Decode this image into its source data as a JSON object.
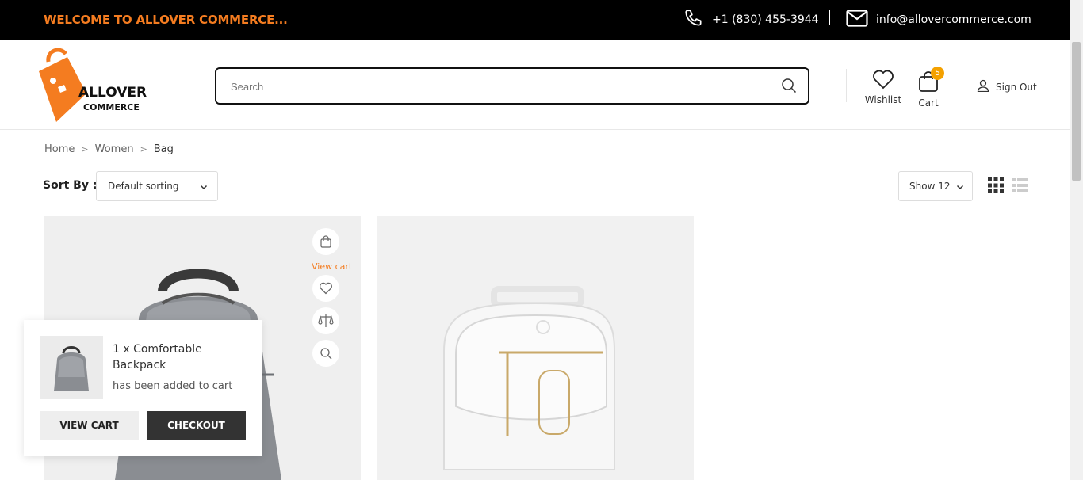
{
  "topbar": {
    "welcome": "WELCOME TO ALLOVER COMMERCE...",
    "phone": "+1 (830) 455-3944",
    "email": "info@allovercommerce.com"
  },
  "logo": {
    "line1": "ALLOVER",
    "line2": "COMMERCE"
  },
  "search": {
    "placeholder": "Search"
  },
  "header": {
    "wishlist_label": "Wishlist",
    "cart_label": "Cart",
    "cart_count": "5",
    "signout_label": "Sign Out"
  },
  "breadcrumb": [
    "Home",
    "Women",
    "Bag"
  ],
  "toolbar": {
    "sort_label": "Sort By :",
    "sort_value": "Default sorting",
    "show_value": "Show 12"
  },
  "product_actions": {
    "view_cart": "View cart"
  },
  "popup": {
    "product": "1 x Comfortable Backpack",
    "message": "has been added to cart",
    "view_cart_button": "VIEW CART",
    "checkout_button": "CHECKOUT"
  },
  "colors": {
    "accent": "#f47c20",
    "topbar_bg": "#000000",
    "badge": "#f4a100"
  }
}
